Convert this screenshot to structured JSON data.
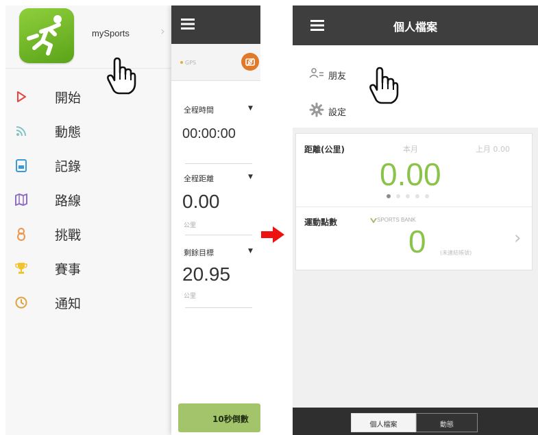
{
  "left_screen": {
    "app_name": "mySports",
    "menu": [
      {
        "label": "開始",
        "icon": "play-icon"
      },
      {
        "label": "動態",
        "icon": "feed-icon"
      },
      {
        "label": "記錄",
        "icon": "record-icon"
      },
      {
        "label": "路線",
        "icon": "route-icon"
      },
      {
        "label": "挑戰",
        "icon": "medal-icon"
      },
      {
        "label": "賽事",
        "icon": "trophy-icon"
      },
      {
        "label": "通知",
        "icon": "clock-icon"
      }
    ],
    "gps_label": "GPS",
    "stats": [
      {
        "label": "全程時間",
        "value": "00:00:00",
        "unit": ""
      },
      {
        "label": "全程距離",
        "value": "0.00",
        "unit": "公里"
      },
      {
        "label": "剩餘目標",
        "value": "20.95",
        "unit": "公里"
      }
    ],
    "countdown_label": "10秒倒數"
  },
  "right_screen": {
    "title": "個人檔案",
    "menu": [
      {
        "label": "朋友",
        "icon": "friends-icon"
      },
      {
        "label": "設定",
        "icon": "gear-icon"
      }
    ],
    "distance": {
      "label": "距離(公里)",
      "current_period": "本月",
      "previous_period": "上月 0.00",
      "value": "0.00",
      "page_count": 5,
      "active_page": 1
    },
    "points": {
      "label": "運動點數",
      "provider": "SPORTS BANK",
      "value": "0",
      "note": "(未連結帳號)"
    },
    "tabs": [
      {
        "label": "個人檔案",
        "active": true
      },
      {
        "label": "動態",
        "active": false
      }
    ]
  },
  "colors": {
    "accent_green": "#8bc34a",
    "logo_green": "#6fb82a",
    "dark_bar": "#3e3e3e",
    "menu_icon_red": "#e8453c",
    "arrow_red": "#ee1111"
  }
}
